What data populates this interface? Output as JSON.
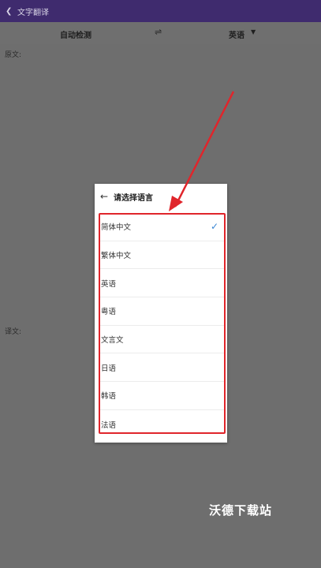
{
  "app": {
    "back_icon": "chevron-left-icon",
    "title": "文字翻译"
  },
  "lang_bar": {
    "source": "自动检测",
    "swap_icon": "swap-arrows-icon",
    "target": "英语",
    "target_caret_icon": "caret-down-icon"
  },
  "labels": {
    "source_text": "原文:",
    "translation_text": "译文:"
  },
  "dialog": {
    "back_icon": "arrow-left-icon",
    "title": "请选择语言",
    "items": [
      {
        "label": "简体中文",
        "selected": true
      },
      {
        "label": "繁体中文",
        "selected": false
      },
      {
        "label": "英语",
        "selected": false
      },
      {
        "label": "粤语",
        "selected": false
      },
      {
        "label": "文言文",
        "selected": false
      },
      {
        "label": "日语",
        "selected": false
      },
      {
        "label": "韩语",
        "selected": false
      },
      {
        "label": "法语",
        "selected": false
      }
    ],
    "check_icon": "check-icon",
    "check_glyph": "✓"
  },
  "annotation": {
    "highlight_color": "#e0252b"
  },
  "watermark": "沃德下载站",
  "colors": {
    "titlebar": "#3f2b6e",
    "overlay": "#6e6e6e",
    "check": "#3a87d4"
  }
}
